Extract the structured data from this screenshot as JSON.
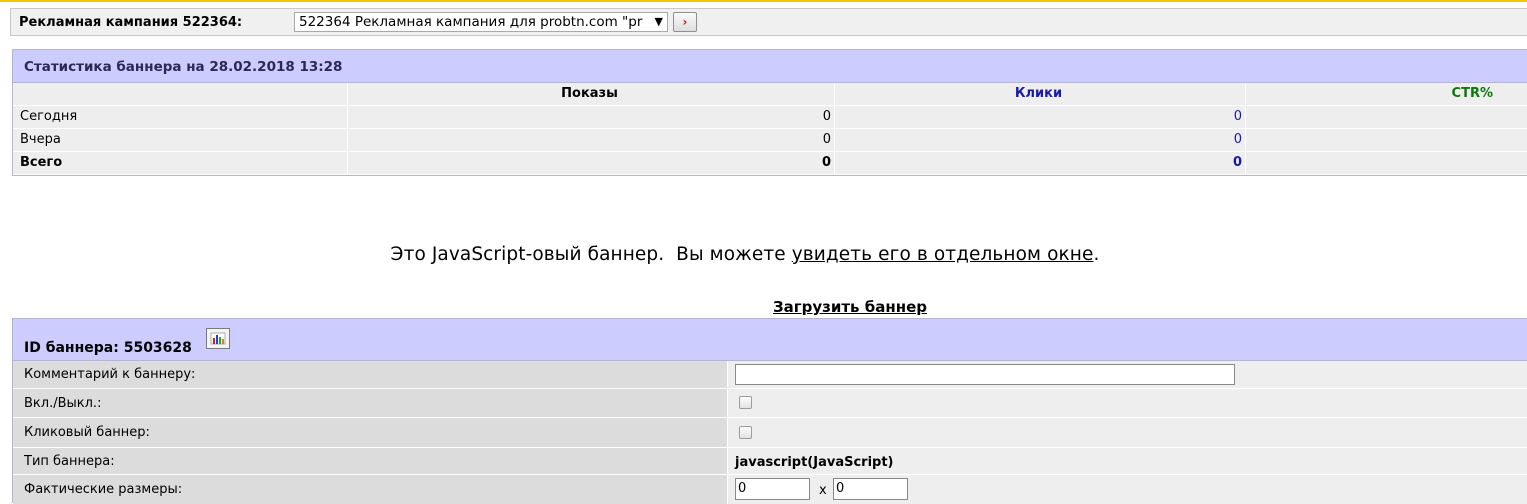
{
  "campaign": {
    "label": "Рекламная кампания 522364:",
    "selected": "522364 Рекламная кампания для probtn.com \"pr",
    "arrow": "▼",
    "go_glyph": "›"
  },
  "stats": {
    "title": "Статистика баннера на 28.02.2018 13:28",
    "columns": [
      "",
      "Показы",
      "Клики",
      "CTR%"
    ],
    "rows": [
      {
        "label": "Сегодня",
        "shows": "0",
        "clicks": "0",
        "ctr": ""
      },
      {
        "label": "Вчера",
        "shows": "0",
        "clicks": "0",
        "ctr": ""
      },
      {
        "label": "Всего",
        "shows": "0",
        "clicks": "0",
        "ctr": ""
      }
    ],
    "colors": {
      "clicks": "#1a1a9a",
      "ctr": "#0a7a0a",
      "header_bg": "#ccccff"
    }
  },
  "banner_note": {
    "prefix": "Это JavaScript-овый баннер.  Вы можете ",
    "link": "увидеть его в отдельном окне",
    "suffix": "."
  },
  "upload_link": "Загрузить баннер",
  "banner": {
    "title": "ID баннера: 5503628",
    "stats_icon": "bar-chart-icon",
    "fields": {
      "comment_label": "Комментарий к баннеру:",
      "comment_value": "",
      "enabled_label": "Вкл./Выкл.:",
      "clickable_label": "Кликовый баннер:",
      "type_label": "Тип баннера:",
      "type_value": "javascript(JavaScript)",
      "size_label": "Фактические размеры:",
      "width": "0",
      "height": "0",
      "size_sep": "x"
    }
  }
}
